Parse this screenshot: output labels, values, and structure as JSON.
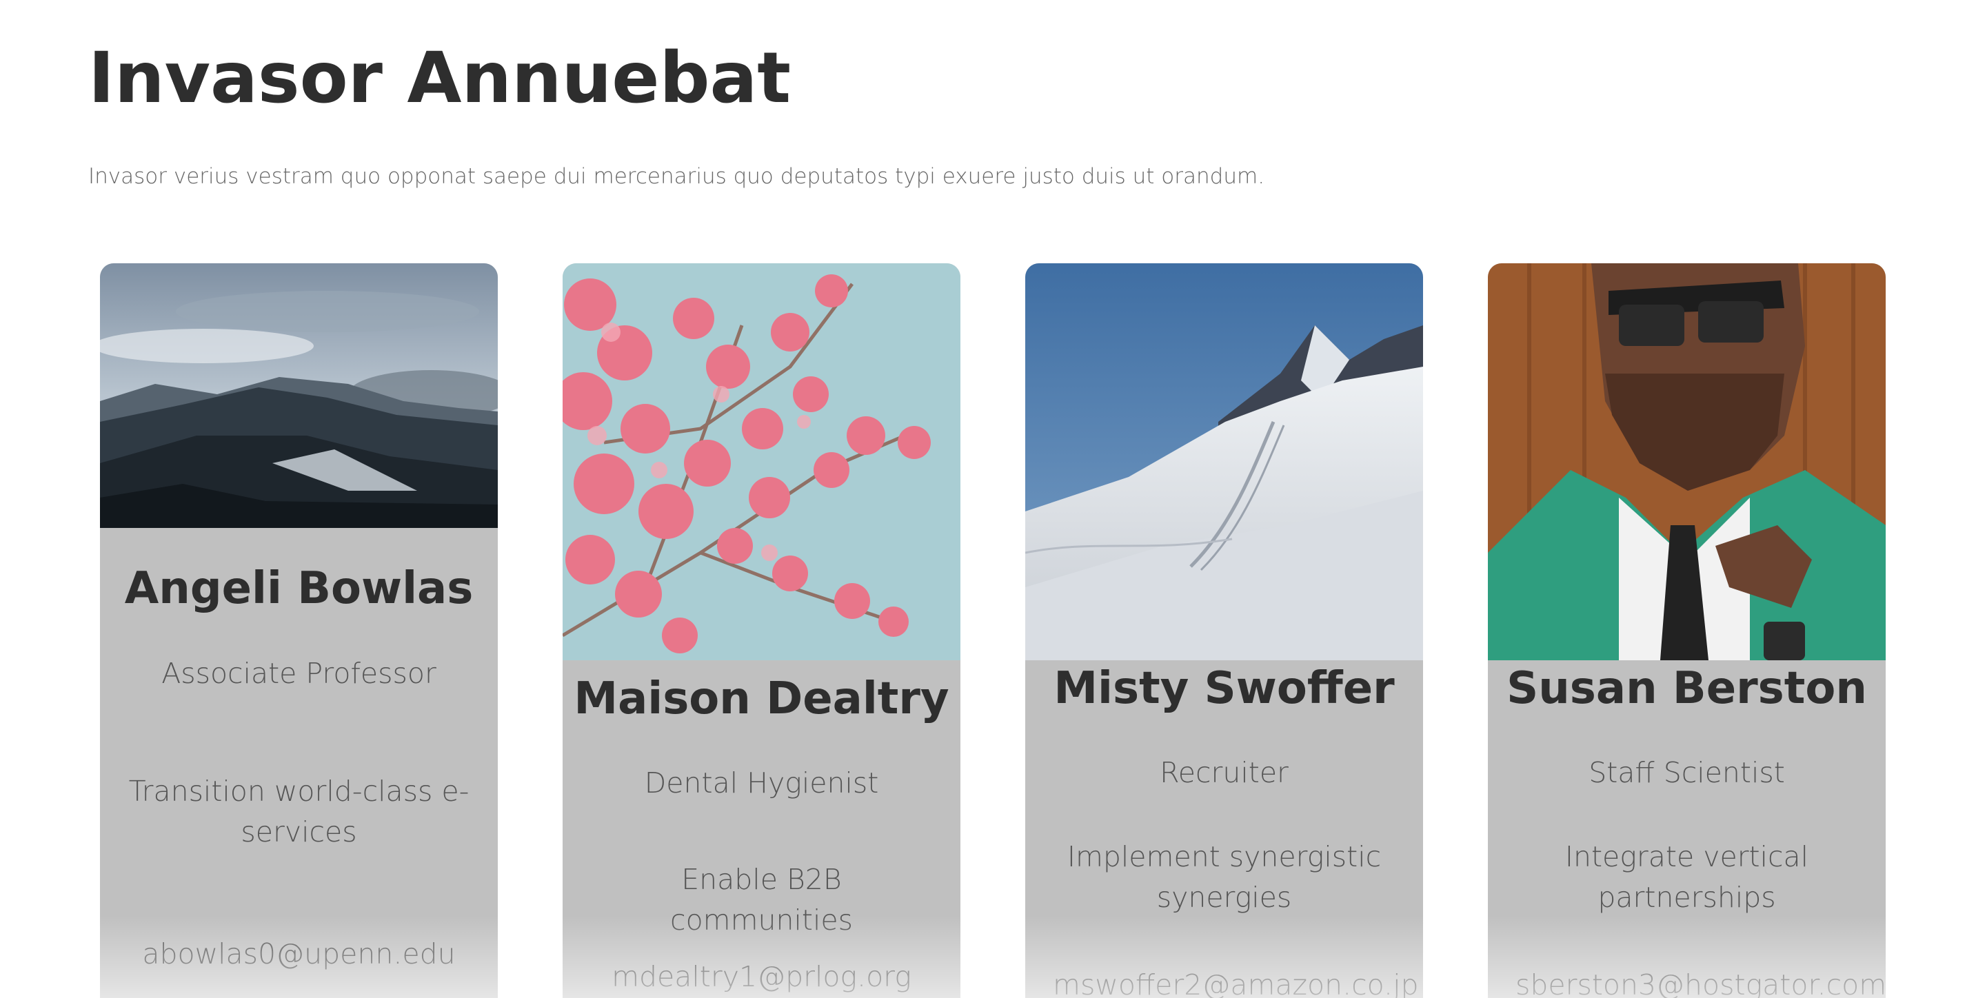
{
  "header": {
    "title": "Invasor Annuebat",
    "subtitle": "Invasor verius vestram quo opponat saepe dui mercenarius quo deputatos typi exuere justo duis ut orandum."
  },
  "cards": [
    {
      "name": "Angeli Bowlas",
      "role": "Associate Professor",
      "tagline": "Transition world-class e-services",
      "email": "abowlas0@upenn.edu",
      "image": "snowy-forest-hills-photo"
    },
    {
      "name": "Maison Dealtry",
      "role": "Dental Hygienist",
      "tagline": "Enable B2B communities",
      "email": "mdealtry1@prlog.org",
      "image": "pink-blossom-branch-photo"
    },
    {
      "name": "Misty Swoffer",
      "role": "Recruiter",
      "tagline": "Implement synergistic synergies",
      "email": "mswoffer2@amazon.co.jp",
      "image": "snowy-mountain-peak-photo"
    },
    {
      "name": "Susan Berston",
      "role": "Staff Scientist",
      "tagline": "Integrate vertical partnerships",
      "email": "sberston3@hostgator.com",
      "image": "man-with-sunglasses-photo"
    }
  ],
  "colors": {
    "card_background": "#c0c0c0",
    "heading": "#2e2e2e",
    "body_text": "#555555"
  }
}
